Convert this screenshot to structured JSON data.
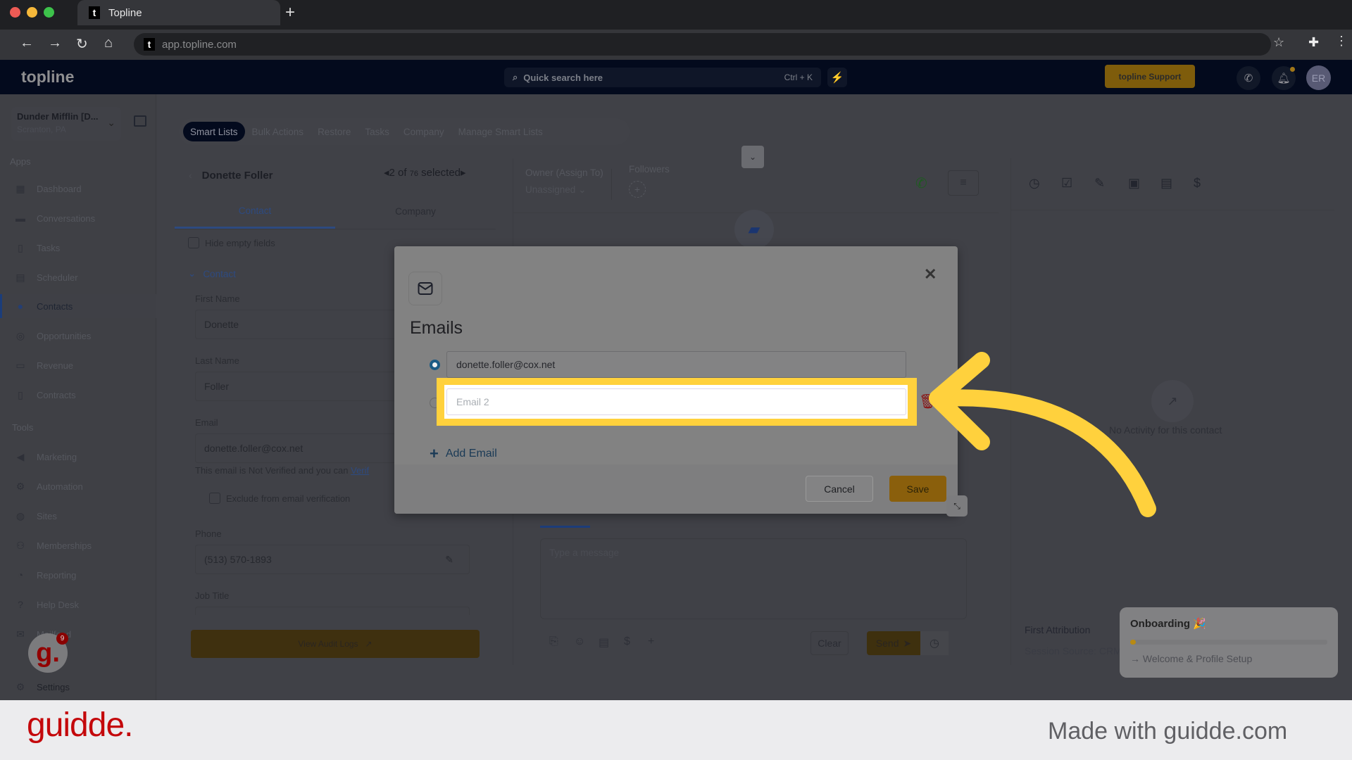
{
  "browser": {
    "tab_title": "Topline",
    "new_tab": "+",
    "url": "app.topline.com",
    "favicon_letter": "t"
  },
  "app_header": {
    "logo": "topline",
    "search_placeholder": "Quick search here",
    "search_shortcut": "Ctrl + K",
    "support_label": "topline Support",
    "avatar_initials": "ER"
  },
  "sidebar": {
    "account_name": "Dunder Mifflin [D...",
    "account_location": "Scranton, PA",
    "apps_heading": "Apps",
    "apps": [
      {
        "label": "Dashboard",
        "icon": "dashboard-icon"
      },
      {
        "label": "Conversations",
        "icon": "chat-icon"
      },
      {
        "label": "Tasks",
        "icon": "task-icon"
      },
      {
        "label": "Scheduler",
        "icon": "calendar-icon"
      },
      {
        "label": "Contacts",
        "icon": "person-icon",
        "active": true
      },
      {
        "label": "Opportunities",
        "icon": "target-icon"
      },
      {
        "label": "Revenue",
        "icon": "card-icon"
      },
      {
        "label": "Contracts",
        "icon": "document-icon"
      }
    ],
    "tools_heading": "Tools",
    "tools": [
      {
        "label": "Marketing",
        "icon": "megaphone-icon"
      },
      {
        "label": "Automation",
        "icon": "gears-icon"
      },
      {
        "label": "Sites",
        "icon": "globe-icon"
      },
      {
        "label": "Memberships",
        "icon": "people-icon"
      },
      {
        "label": "Reporting",
        "icon": "pie-chart-icon"
      },
      {
        "label": "Help Desk",
        "icon": "help-icon"
      },
      {
        "label": "Mailfeed",
        "icon": "mail-icon"
      }
    ],
    "settings_label": "Settings",
    "guidde_badge_count": "9"
  },
  "top_tabs": [
    "Smart Lists",
    "Bulk Actions",
    "Restore",
    "Tasks",
    "Company",
    "Manage Smart Lists"
  ],
  "contact_panel": {
    "name": "Donette Foller",
    "pager_current": "2 of ",
    "pager_total": "76",
    "pager_suffix": " selected",
    "tabs": [
      "Contact",
      "Company"
    ],
    "hide_empty_label": "Hide empty fields",
    "section_label": "Contact",
    "fields": {
      "first_name_label": "First Name",
      "first_name_value": "Donette",
      "last_name_label": "Last Name",
      "last_name_value": "Foller",
      "email_label": "Email",
      "email_value": "donette.foller@cox.net",
      "verify_note": "This email is Not Verified and you can ",
      "verify_link": "Verif",
      "exclude_label": "Exclude from email verification",
      "phone_label": "Phone",
      "phone_value": "(513) 570-1893",
      "job_title_label": "Job Title"
    },
    "audit_logs_label": "View Audit Logs"
  },
  "middle_panel": {
    "owner_label": "Owner (Assign To)",
    "owner_value": "Unassigned",
    "followers_label": "Followers",
    "message_placeholder": "Type a message",
    "clear_label": "Clear",
    "send_label": "Send"
  },
  "right_panel": {
    "no_activity": "No Activity for this contact",
    "first_attribution": "First Attribution",
    "session_source": "Session Source: CRM UI"
  },
  "onboarding": {
    "title": "Onboarding 🎉",
    "progress_percent": 3,
    "step": "Welcome & Profile Setup"
  },
  "modal": {
    "title": "Emails",
    "emails": [
      {
        "value": "donette.foller@cox.net",
        "primary": true
      },
      {
        "value": "",
        "placeholder": "Email 2",
        "primary": false
      }
    ],
    "add_email_label": "Add Email",
    "cancel_label": "Cancel",
    "save_label": "Save"
  },
  "footer": {
    "brand": "guidde.",
    "tagline": "Made with guidde.com"
  },
  "colors": {
    "highlight": "#ffd13d",
    "brand_gold": "#8a5f0c",
    "guidde_red": "#c4080b"
  }
}
